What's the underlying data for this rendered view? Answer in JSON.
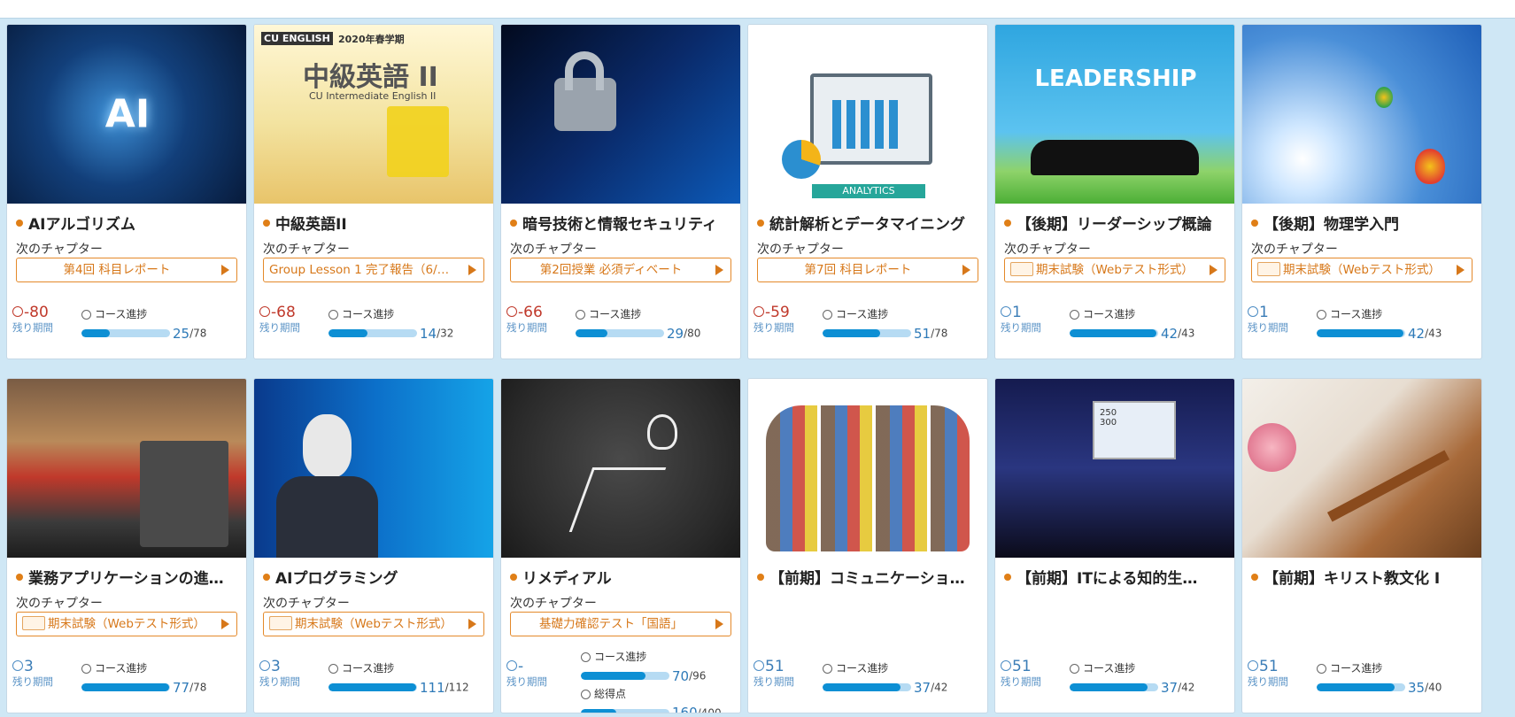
{
  "labels": {
    "next_chapter": "次のチャプター",
    "remaining": "残り期間",
    "progress": "コース進捗",
    "score": "総得点"
  },
  "colors": {
    "accent": "#e07f17",
    "progress": "#0d8fd4",
    "background": "#cfe7f5"
  },
  "courses": [
    {
      "title": "AIアルゴリズム",
      "next": "第4回 科目レポート",
      "remaining": "-80",
      "progress": {
        "current": "25",
        "total": "/78"
      },
      "image": {
        "text": "AI"
      }
    },
    {
      "title": "中級英語II",
      "next": "Group Lesson 1 完了報告（6/…",
      "remaining": "-68",
      "progress": {
        "current": "14",
        "total": "/32"
      },
      "image": {
        "line1": "2020年春学期",
        "line2": "中級英語 II",
        "line3": "CU Intermediate English II",
        "brand": "CU ENGLISH"
      }
    },
    {
      "title": "暗号技術と情報セキュリティ",
      "next": "第2回授業 必須ディベート",
      "remaining": "-66",
      "progress": {
        "current": "29",
        "total": "/80"
      }
    },
    {
      "title": "統計解析とデータマイニング",
      "next": "第7回 科目レポート",
      "remaining": "-59",
      "progress": {
        "current": "51",
        "total": "/78"
      },
      "image": {
        "text": "ANALYTICS"
      }
    },
    {
      "title": "【後期】リーダーシップ概論",
      "next": "期末試験（Webテスト形式）",
      "remaining": "1",
      "progress": {
        "current": "42",
        "total": "/43"
      },
      "image": {
        "text": "LEADERSHIP"
      }
    },
    {
      "title": "【後期】物理学入門",
      "next": "期末試験（Webテスト形式）",
      "remaining": "1",
      "progress": {
        "current": "42",
        "total": "/43"
      }
    },
    {
      "title": "業務アプリケーションの進…",
      "next": "期末試験（Webテスト形式）",
      "remaining": "3",
      "progress": {
        "current": "77",
        "total": "/78"
      }
    },
    {
      "title": "AIプログラミング",
      "next": "期末試験（Webテスト形式）",
      "remaining": "3",
      "progress": {
        "current": "111",
        "total": "/112"
      }
    },
    {
      "title": "リメディアル",
      "next": "基礎力確認テスト「国語」",
      "remaining": "-",
      "progress": {
        "current": "70",
        "total": "/96"
      },
      "score": {
        "current": "160",
        "total": "/400"
      }
    },
    {
      "title": "【前期】コミュニケーショ…",
      "remaining": "51",
      "progress": {
        "current": "37",
        "total": "/42"
      }
    },
    {
      "title": "【前期】ITによる知的生…",
      "remaining": "51",
      "progress": {
        "current": "37",
        "total": "/42"
      },
      "image": {
        "text": "250 300"
      }
    },
    {
      "title": "【前期】キリスト教文化 I",
      "remaining": "51",
      "progress": {
        "current": "35",
        "total": "/40"
      }
    }
  ]
}
